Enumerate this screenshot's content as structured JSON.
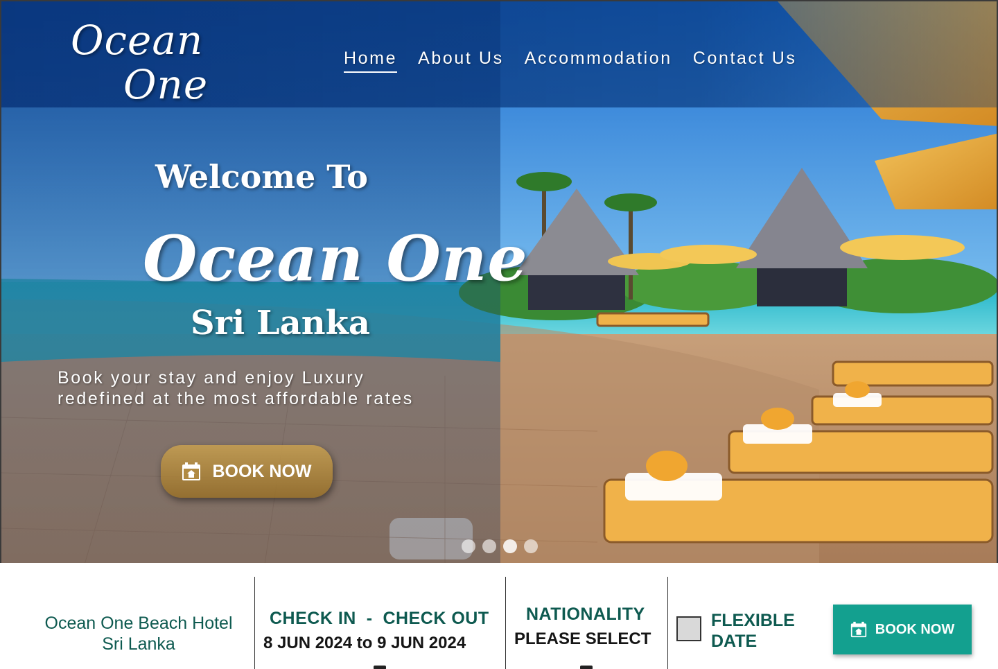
{
  "brand": {
    "logo_line1": "Ocean",
    "logo_line2": "One"
  },
  "nav": {
    "items": [
      {
        "label": "Home",
        "active": true
      },
      {
        "label": "About Us",
        "active": false
      },
      {
        "label": "Accommodation",
        "active": false
      },
      {
        "label": "Contact Us",
        "active": false
      }
    ]
  },
  "hero": {
    "welcome": "Welcome To",
    "brand_name": "Ocean One",
    "location": "Sri Lanka",
    "tagline_line1": "Book your stay and enjoy Luxury",
    "tagline_line2": "redefined at the most affordable rates",
    "book_button": "BOOK NOW",
    "book_button_icon": "calendar-icon",
    "slides": {
      "count": 4,
      "active_index": 2
    }
  },
  "booking_bar": {
    "hotel_line1": "Ocean One Beach Hotel",
    "hotel_line2": "Sri Lanka",
    "check_in_label": "CHECK IN",
    "separator": "-",
    "check_out_label": "CHECK OUT",
    "dates": "8 JUN 2024 to 9 JUN 2024",
    "nationality_label": "NATIONALITY",
    "nationality_value": "PLEASE SELECT",
    "flexible_line1": "FLEXIBLE",
    "flexible_line2": "DATE",
    "flexible_checked": false,
    "book_button": "BOOK NOW",
    "book_button_icon": "calendar-icon"
  },
  "colors": {
    "primary_blue": "#0b3c86",
    "teal_text": "#0e5a50",
    "teal_button": "#13a08f",
    "gold_button": "#b58a3c"
  }
}
